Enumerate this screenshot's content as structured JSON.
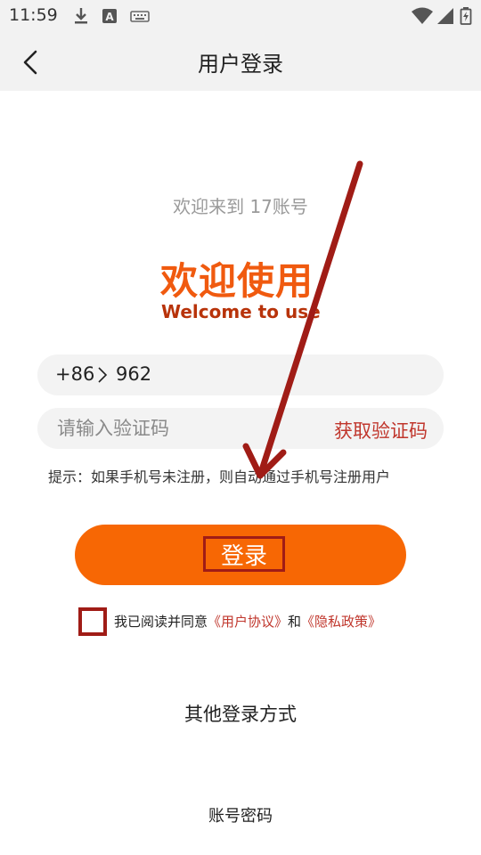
{
  "status_bar": {
    "time": "11:59",
    "icons": [
      "download-icon",
      "text-a-icon",
      "keyboard-icon",
      "wifi-icon",
      "signal-icon",
      "battery-icon"
    ]
  },
  "header": {
    "title": "用户登录",
    "back_icon": "chevron-left-icon"
  },
  "welcome_text": "欢迎来到 17账号",
  "logo": {
    "cn": "欢迎使用",
    "en": "Welcome to use"
  },
  "phone": {
    "country_code": "+86",
    "value": "962"
  },
  "code": {
    "placeholder": "请输入验证码",
    "get_code_label": "获取验证码"
  },
  "hint": "提示：如果手机号未注册，则自动通过手机号注册用户",
  "login_button": "登录",
  "agreement": {
    "prefix": "我已阅读并同意",
    "user_agreement": "《用户协议》",
    "and": "和",
    "privacy_policy": "《隐私政策》",
    "checked": false
  },
  "other_login": {
    "title": "其他登录方式",
    "password_login": "账号密码"
  },
  "colors": {
    "accent": "#f76704",
    "link": "#c0362c",
    "logo_cn": "#f05a0f",
    "logo_en": "#b8330a",
    "annotation": "#a01c16"
  }
}
